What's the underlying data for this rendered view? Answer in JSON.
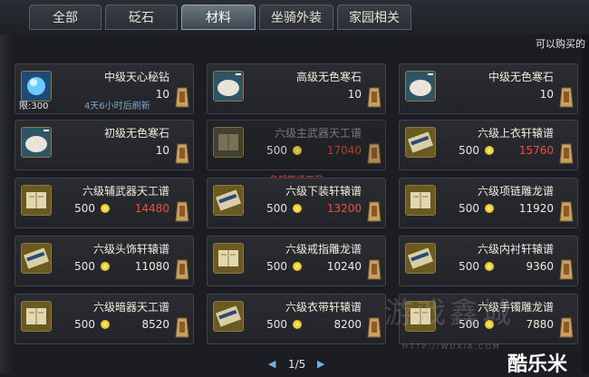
{
  "tabs": [
    {
      "label": "全部"
    },
    {
      "label": "砭石"
    },
    {
      "label": "材料"
    },
    {
      "label": "坐骑外装"
    },
    {
      "label": "家园相关"
    }
  ],
  "header_note": "可以购买的",
  "items": [
    {
      "name": "中级天心秘钻",
      "qty": "10",
      "limit": "限:300",
      "refresh": "4天6小时后刷新"
    },
    {
      "name": "高级无色寒石",
      "qty": "10"
    },
    {
      "name": "中级无色寒石",
      "qty": "10"
    },
    {
      "name": "初级无色寒石",
      "qty": "10"
    },
    {
      "name": "六级主武器天工谱",
      "coin": "500",
      "price": "17040",
      "warning": "名望等级不足"
    },
    {
      "name": "六级上衣轩辕谱",
      "coin": "500",
      "price": "15760"
    },
    {
      "name": "六级辅武器天工谱",
      "coin": "500",
      "price": "14480"
    },
    {
      "name": "六级下装轩辕谱",
      "coin": "500",
      "price": "13200"
    },
    {
      "name": "六级项链雕龙谱",
      "coin": "500",
      "price": "11920"
    },
    {
      "name": "六级头饰轩辕谱",
      "coin": "500",
      "price": "11080"
    },
    {
      "name": "六级戒指雕龙谱",
      "coin": "500",
      "price": "10240"
    },
    {
      "name": "六级内衬轩辕谱",
      "coin": "500",
      "price": "9360"
    },
    {
      "name": "六级暗器天工谱",
      "coin": "500",
      "price": "8520"
    },
    {
      "name": "六级衣带轩辕谱",
      "coin": "500",
      "price": "8200"
    },
    {
      "name": "六级手镯雕龙谱",
      "coin": "500",
      "price": "7880"
    }
  ],
  "pager": {
    "prev": "◀",
    "page": "1/5",
    "next": "▶"
  },
  "watermark": "游戏鑫城",
  "watermark_url": "HTTP://WUXIA.COM",
  "logo": "酷乐米",
  "colors": {
    "price_red": "#ff4a3c",
    "price_white": "#f0ece0",
    "coin": "#f2c200",
    "refresh_blue": "#7fa5c8"
  }
}
